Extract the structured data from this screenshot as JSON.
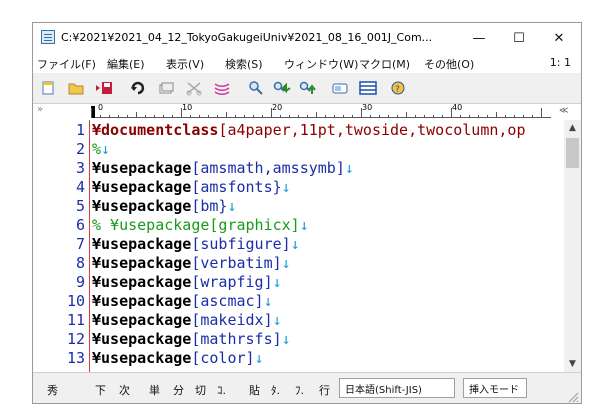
{
  "window": {
    "title": "C:¥2021¥2021_04_12_TokyoGakugeiUniv¥2021_08_16_001J_Com...",
    "minimize": "—",
    "maximize": "☐",
    "close": "✕"
  },
  "menu": {
    "items": [
      "ファイル(F)",
      "編集(E)",
      "表示(V)",
      "検索(S)",
      "ウィンドウ(W)",
      "マクロ(M)",
      "その他(O)"
    ],
    "page_indicator": "1: 1"
  },
  "toolbar": {
    "buttons": [
      "new-file",
      "open-folder",
      "save",
      "undo",
      "copy",
      "cut",
      "paste",
      "search",
      "find-next",
      "find-prev",
      "grep",
      "window-tile",
      "help"
    ]
  },
  "ruler": {
    "labels": [
      "0",
      "10",
      "20",
      "30",
      "40"
    ],
    "end_mark": "≪"
  },
  "gutter_mark": "»",
  "lines": [
    {
      "num": "1",
      "seg": [
        {
          "t": "¥documentclass",
          "c": "dc"
        },
        {
          "t": "[a4paper,11pt,twoside,twocolumn,op",
          "c": "dcarg"
        }
      ]
    },
    {
      "num": "2",
      "seg": [
        {
          "t": "%",
          "c": "cm"
        },
        {
          "t": "↓",
          "c": "mk"
        }
      ]
    },
    {
      "num": "3",
      "seg": [
        {
          "t": "¥usepackage",
          "c": "kw"
        },
        {
          "t": "[amsmath,amssymb]",
          "c": "arg"
        },
        {
          "t": "↓",
          "c": "mk"
        }
      ]
    },
    {
      "num": "4",
      "seg": [
        {
          "t": "¥usepackage",
          "c": "kw"
        },
        {
          "t": "[amsfonts}",
          "c": "arg"
        },
        {
          "t": "↓",
          "c": "mk"
        }
      ]
    },
    {
      "num": "5",
      "seg": [
        {
          "t": "¥usepackage",
          "c": "kw"
        },
        {
          "t": "[bm}",
          "c": "arg"
        },
        {
          "t": "↓",
          "c": "mk"
        }
      ]
    },
    {
      "num": "6",
      "seg": [
        {
          "t": "% ¥usepackage[graphicx]",
          "c": "cm"
        },
        {
          "t": "↓",
          "c": "mk"
        }
      ]
    },
    {
      "num": "7",
      "seg": [
        {
          "t": "¥usepackage",
          "c": "kw"
        },
        {
          "t": "[subfigure]",
          "c": "arg"
        },
        {
          "t": "↓",
          "c": "mk"
        }
      ]
    },
    {
      "num": "8",
      "seg": [
        {
          "t": "¥usepackage",
          "c": "kw"
        },
        {
          "t": "[verbatim]",
          "c": "arg"
        },
        {
          "t": "↓",
          "c": "mk"
        }
      ]
    },
    {
      "num": "9",
      "seg": [
        {
          "t": "¥usepackage",
          "c": "kw"
        },
        {
          "t": "[wrapfig]",
          "c": "arg"
        },
        {
          "t": "↓",
          "c": "mk"
        }
      ]
    },
    {
      "num": "10",
      "seg": [
        {
          "t": "¥usepackage",
          "c": "kw"
        },
        {
          "t": "[ascmac]",
          "c": "arg"
        },
        {
          "t": "↓",
          "c": "mk"
        }
      ]
    },
    {
      "num": "11",
      "seg": [
        {
          "t": "¥usepackage",
          "c": "kw"
        },
        {
          "t": "[makeidx]",
          "c": "arg"
        },
        {
          "t": "↓",
          "c": "mk"
        }
      ]
    },
    {
      "num": "12",
      "seg": [
        {
          "t": "¥usepackage",
          "c": "kw"
        },
        {
          "t": "[mathrsfs]",
          "c": "arg"
        },
        {
          "t": "↓",
          "c": "mk"
        }
      ]
    },
    {
      "num": "13",
      "seg": [
        {
          "t": "¥usepackage",
          "c": "kw"
        },
        {
          "t": "[color]",
          "c": "arg"
        },
        {
          "t": "↓",
          "c": "mk"
        }
      ]
    }
  ],
  "statusbar": {
    "items": [
      "秀",
      "下",
      "次",
      "単",
      "分",
      "切",
      "ｺ.",
      "貼",
      "ﾀ.",
      "ﾌ.",
      "行"
    ],
    "encoding": "日本語(Shift-JIS)",
    "insert_mode": "挿入モード"
  }
}
